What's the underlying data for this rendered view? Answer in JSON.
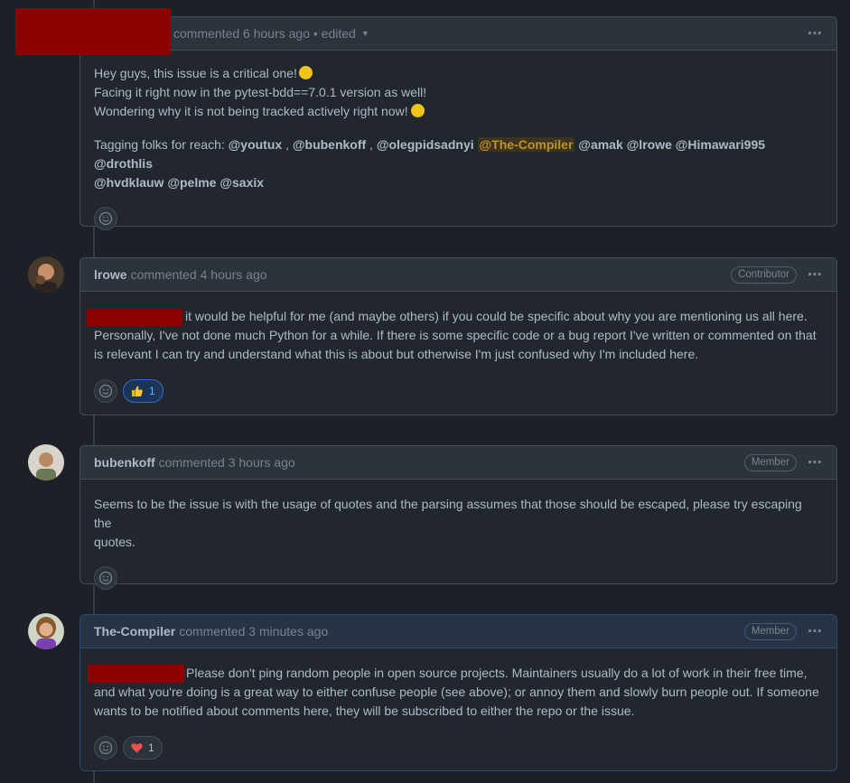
{
  "comments": [
    {
      "author": "",
      "meta": "commented 6 hours ago • edited",
      "role": "",
      "lines": {
        "l1": "Hey guys, this issue is a critical one!",
        "l2": "Facing it right now in the pytest-bdd==7.0.1 version as well!",
        "l3": "Wondering why it is not being tracked actively right now!",
        "tag_prefix": "Tagging folks for reach:",
        "m_youtux": "@youtux",
        "m_bubenkoff": "@bubenkoff",
        "m_oleg": "@olegpidsadnyi",
        "m_compiler": "@The-Compiler",
        "m_amak": "@amak",
        "m_lrowe": "@lrowe",
        "m_hima": "@Himawari995",
        "m_drothlis": "@drothlis",
        "m_hvdk": "@hvdklauw",
        "m_pelme": "@pelme",
        "m_saxix": "@saxix"
      }
    },
    {
      "author": "lrowe",
      "meta": "commented 4 hours ago",
      "role": "Contributor",
      "lines": {
        "l1": "it would be helpful for me (and maybe others) if you could be specific about why you are mentioning us all here.",
        "l2": "Personally, I've not done much Python for a while. If there is some specific code or a bug report I've written or commented on that",
        "l3": "is relevant I can try and understand what this is about but otherwise I'm just confused why I'm included here."
      },
      "reaction": {
        "emoji": "thumbs-up",
        "count": "1"
      }
    },
    {
      "author": "bubenkoff",
      "meta": "commented 3 hours ago",
      "role": "Member",
      "lines": {
        "l1": "Seems to be the issue is with the usage of quotes and the parsing assumes that those should be escaped, please try escaping the",
        "l2": "quotes."
      }
    },
    {
      "author": "The-Compiler",
      "meta": "commented 3 minutes ago",
      "role": "Member",
      "lines": {
        "l1": "Please don't ping random people in open source projects. Maintainers usually do a lot of work in their free time,",
        "l2": "and what you're doing is a great way to either confuse people (see above); or annoy them and slowly burn people out. If someone",
        "l3": "wants to be notified about comments here, they will be subscribed to either the repo or the issue."
      },
      "reaction": {
        "emoji": "heart",
        "count": "1"
      }
    }
  ],
  "icons": {
    "kebab": "⋯",
    "caret": "▼"
  },
  "colors": {
    "redaction": "#8b0000",
    "mention_highlight": "#c69026",
    "accent": "#316dca"
  }
}
